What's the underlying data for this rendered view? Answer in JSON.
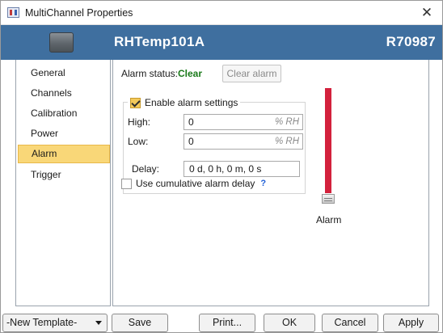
{
  "window": {
    "title": "MultiChannel Properties",
    "close_glyph": "✕"
  },
  "header": {
    "device_name": "RHTemp101A",
    "serial": "R70987",
    "device_icon": "device-logger-icon"
  },
  "sidebar": {
    "items": [
      {
        "label": "General",
        "active": false
      },
      {
        "label": "Channels",
        "active": false
      },
      {
        "label": "Calibration",
        "active": false
      },
      {
        "label": "Power",
        "active": false
      },
      {
        "label": "Alarm",
        "active": true
      },
      {
        "label": "Trigger",
        "active": false
      }
    ]
  },
  "alarm": {
    "status_label": "Alarm status:",
    "status_value": "Clear",
    "clear_button": "Clear alarm",
    "enable_label": "Enable alarm settings",
    "enable_checked": true,
    "high_label": "High:",
    "high_value": "0",
    "high_unit": "% RH",
    "low_label": "Low:",
    "low_value": "0",
    "low_unit": "% RH",
    "delay_label": "Delay:",
    "delay_value": "0 d, 0 h, 0 m, 0 s",
    "cumulative_label": "Use cumulative alarm delay",
    "cumulative_checked": false,
    "help_glyph": "?",
    "indicator_caption": "Alarm"
  },
  "footer": {
    "template_label": "-New Template-",
    "save": "Save",
    "print": "Print...",
    "ok": "OK",
    "cancel": "Cancel",
    "apply": "Apply"
  },
  "colors": {
    "header_bg": "#3f6f9f",
    "active_nav": "#f9d778",
    "status_clear": "#1a7a1a",
    "alarm_bar": "#d3213c",
    "help": "#1f5fd6"
  }
}
